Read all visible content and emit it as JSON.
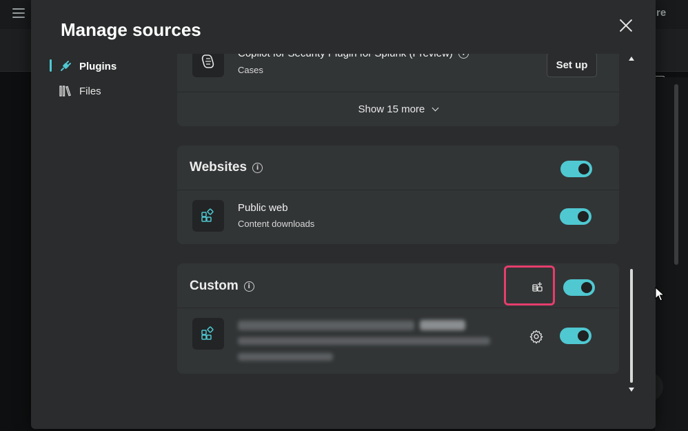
{
  "background": {
    "topright_text": "re"
  },
  "modal": {
    "title": "Manage sources",
    "nav": [
      {
        "label": "Plugins",
        "icon": "plug-icon",
        "active": true
      },
      {
        "label": "Files",
        "icon": "library-icon",
        "active": false
      }
    ],
    "plugins_card": {
      "item": {
        "title": "Copilot for Security Plugin for Splunk (Preview)",
        "subtitle": "Cases",
        "action_label": "Set up"
      },
      "show_more_label": "Show 15 more"
    },
    "websites": {
      "title": "Websites",
      "enabled": true,
      "items": [
        {
          "title": "Public web",
          "subtitle": "Content downloads",
          "enabled": true
        }
      ]
    },
    "custom": {
      "title": "Custom",
      "enabled": true,
      "items": [
        {
          "enabled": true,
          "redacted": true
        }
      ]
    }
  },
  "colors": {
    "accent": "#4fc8d1",
    "highlight": "#e63d6d",
    "modal_bg": "#2a2c2d",
    "card_bg": "#323536"
  }
}
